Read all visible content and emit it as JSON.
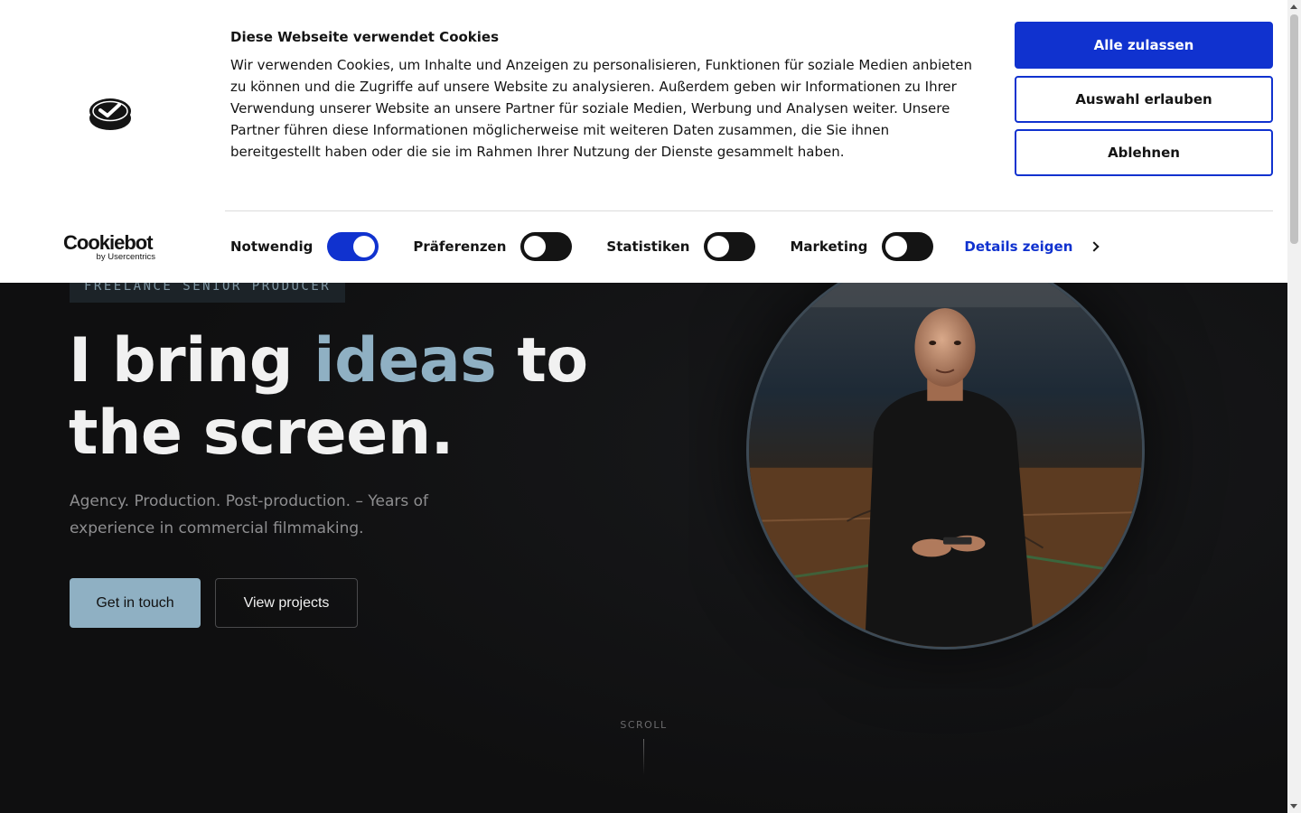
{
  "hero": {
    "eyebrow": "FREELANCE SENIOR PRODUCER",
    "headline_part1": "I bring ",
    "headline_accent": "ideas",
    "headline_part2": " to the screen.",
    "subline": "Agency. Production. Post-production. – Years of experience in commercial filmmaking.",
    "cta_primary": "Get in touch",
    "cta_secondary": "View projects",
    "scroll_label": "SCROLL",
    "accent_color": "#8fb0c3"
  },
  "cookie_banner": {
    "title": "Diese Webseite verwendet Cookies",
    "text": "Wir verwenden Cookies, um Inhalte und Anzeigen zu personalisieren, Funktionen für soziale Medien anbieten zu können und die Zugriffe auf unsere Website zu analysieren. Außerdem geben wir Informationen zu Ihrer Verwendung unserer Website an unsere Partner für soziale Medien, Werbung und Analysen weiter. Unsere Partner führen diese Informationen möglicherweise mit weiteren Daten zusammen, die Sie ihnen bereitgestellt haben oder die sie im Rahmen Ihrer Nutzung der Dienste gesammelt haben.",
    "buttons": {
      "allow_all": "Alle zulassen",
      "allow_selection": "Auswahl erlauben",
      "deny": "Ablehnen"
    },
    "toggles": [
      {
        "label": "Notwendig",
        "on": true
      },
      {
        "label": "Präferenzen",
        "on": false
      },
      {
        "label": "Statistiken",
        "on": false
      },
      {
        "label": "Marketing",
        "on": false
      }
    ],
    "details_link": "Details zeigen",
    "logo_brand": "Cookiebot",
    "logo_by": "by Usercentrics",
    "brand_color": "#1032cf"
  }
}
